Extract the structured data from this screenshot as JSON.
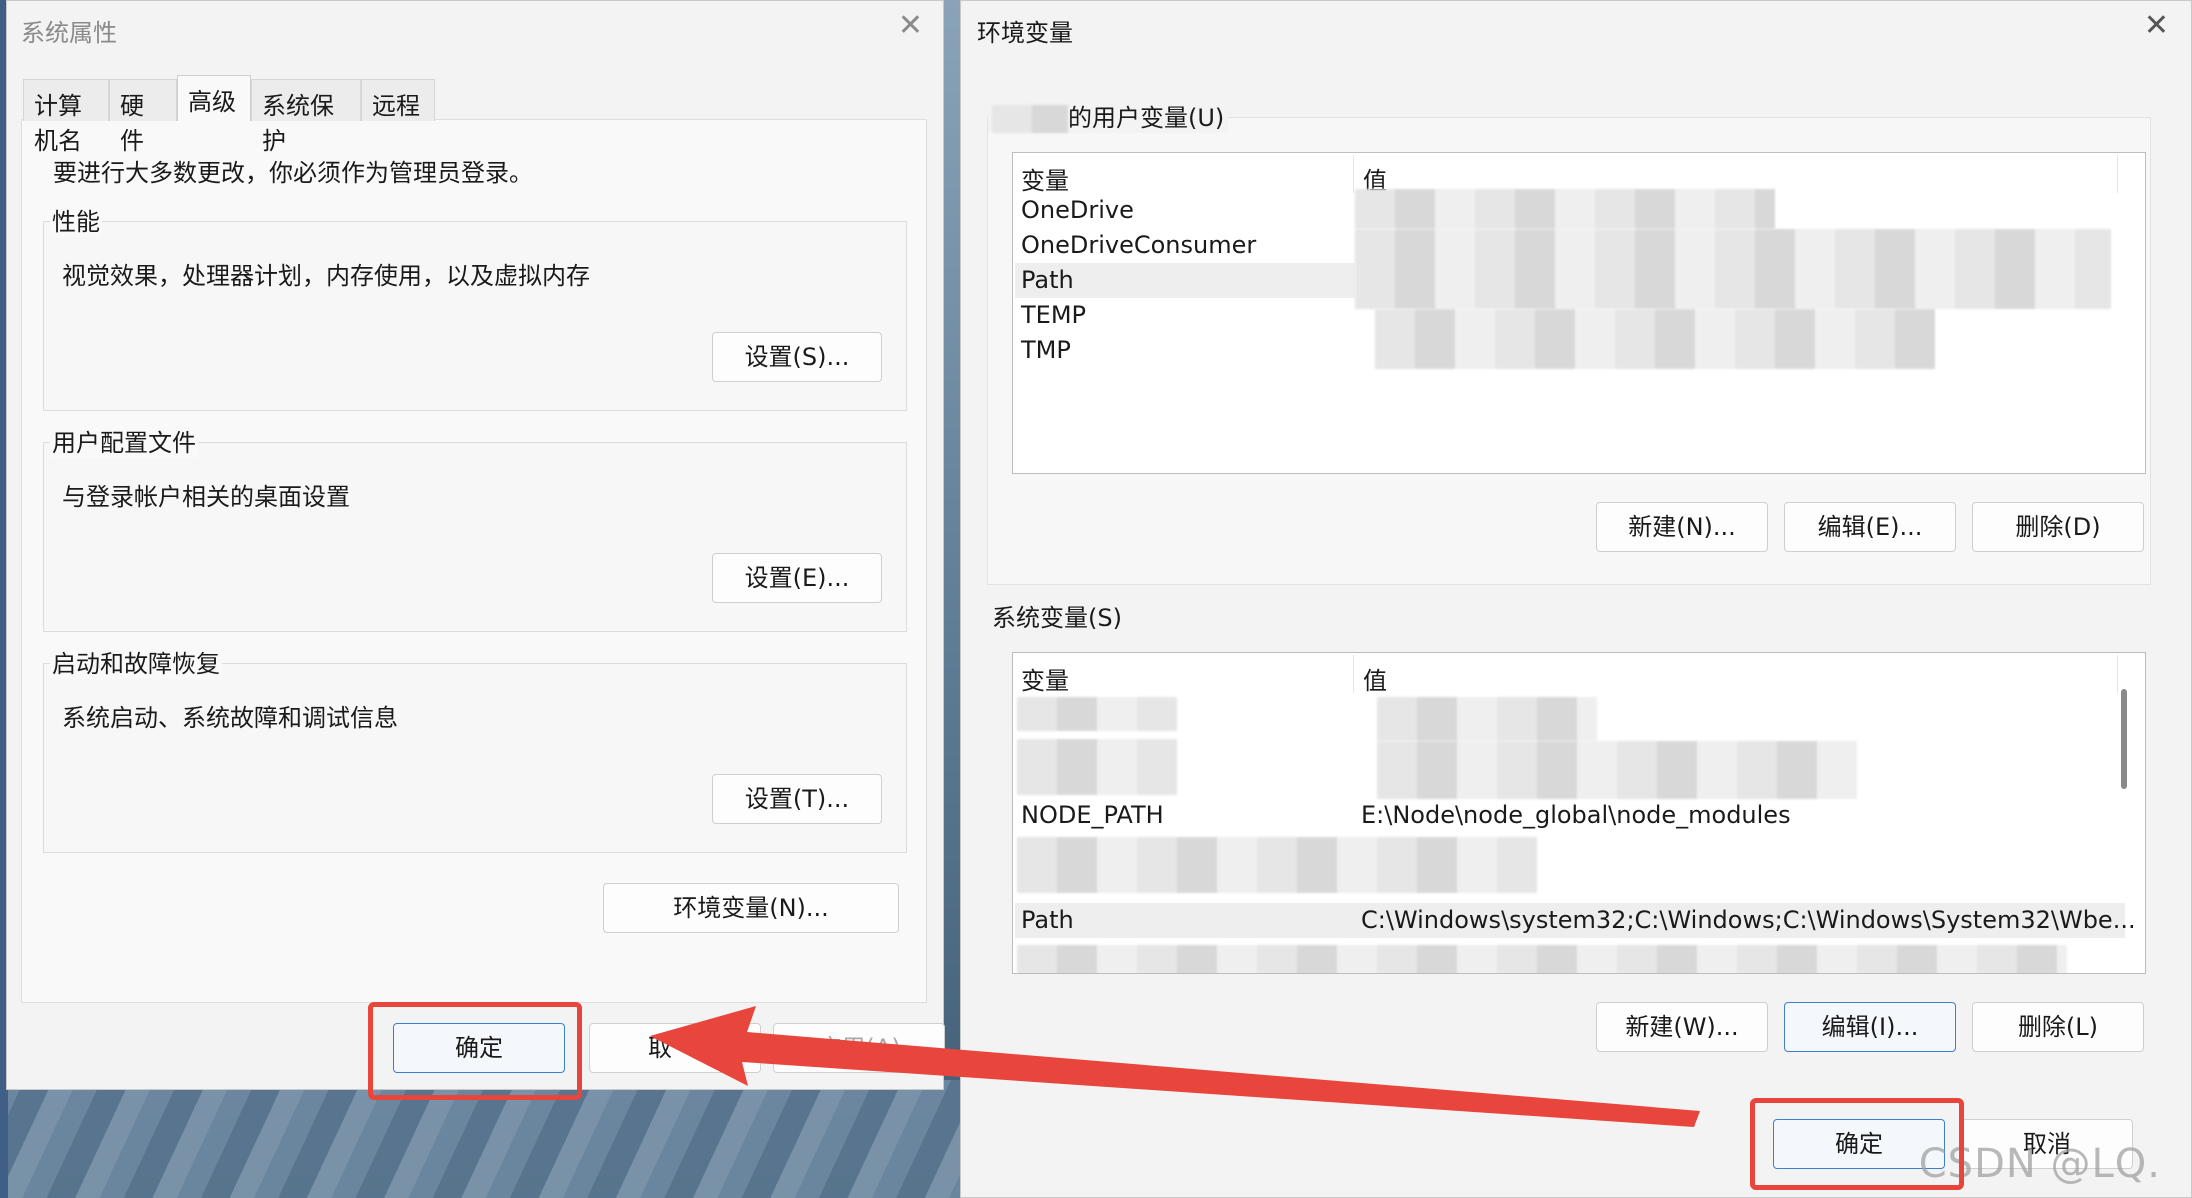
{
  "system_properties": {
    "title": "系统属性",
    "tabs": [
      {
        "label": "计算机名"
      },
      {
        "label": "硬件"
      },
      {
        "label": "高级"
      },
      {
        "label": "系统保护"
      },
      {
        "label": "远程"
      }
    ],
    "active_tab": "高级",
    "admin_note": "要进行大多数更改，你必须作为管理员登录。",
    "groups": [
      {
        "title": "性能",
        "desc": "视觉效果，处理器计划，内存使用，以及虚拟内存",
        "button": "设置(S)..."
      },
      {
        "title": "用户配置文件",
        "desc": "与登录帐户相关的桌面设置",
        "button": "设置(E)..."
      },
      {
        "title": "启动和故障恢复",
        "desc": "系统启动、系统故障和调试信息",
        "button": "设置(T)..."
      }
    ],
    "env_button": "环境变量(N)...",
    "footer": {
      "ok": "确定",
      "cancel_partial": "取",
      "apply": "应用(A)"
    }
  },
  "environment_variables": {
    "title": "环境变量",
    "user_section": {
      "label": "的用户变量(U)",
      "col_name": "变量",
      "col_value": "值",
      "rows": [
        {
          "name": "OneDrive",
          "value": ""
        },
        {
          "name": "OneDriveConsumer",
          "value": ""
        },
        {
          "name": "Path",
          "value": ""
        },
        {
          "name": "TEMP",
          "value": ""
        },
        {
          "name": "TMP",
          "value": ""
        }
      ],
      "buttons": {
        "new": "新建(N)...",
        "edit": "编辑(E)...",
        "delete": "删除(D)"
      }
    },
    "system_section": {
      "label": "系统变量(S)",
      "col_name": "变量",
      "col_value": "值",
      "rows": [
        {
          "name": "",
          "value": ""
        },
        {
          "name": "",
          "value": ""
        },
        {
          "name": "NODE_PATH",
          "value": "E:\\Node\\node_global\\node_modules"
        },
        {
          "name": "",
          "value": ""
        },
        {
          "name": "Path",
          "value": "C:\\Windows\\system32;C:\\Windows;C:\\Windows\\System32\\Wbe..."
        },
        {
          "name": "",
          "value": ""
        }
      ],
      "buttons": {
        "new": "新建(W)...",
        "edit": "编辑(I)...",
        "delete": "删除(L)"
      }
    },
    "footer": {
      "ok": "确定",
      "cancel": "取消"
    }
  },
  "watermark": "CSDN @LQ.",
  "colors": {
    "annotation": "#e8453c",
    "focus_border": "#3b7fd0"
  }
}
